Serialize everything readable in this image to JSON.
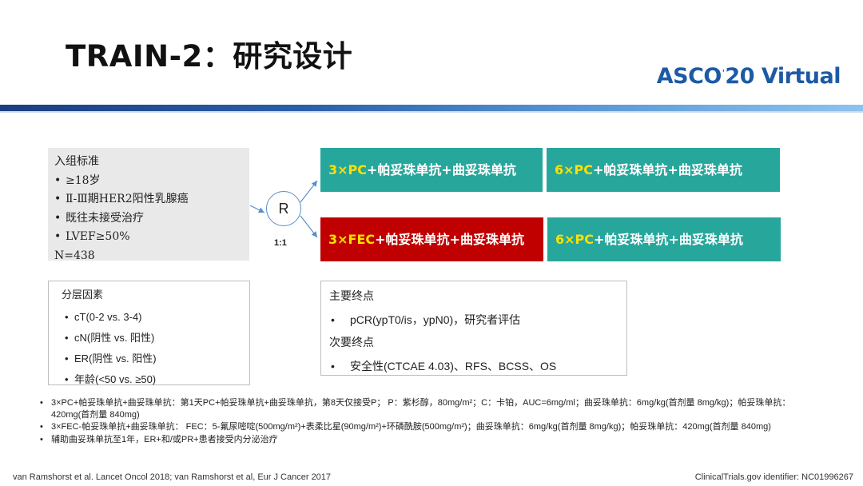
{
  "title": "TRAIN-2：研究设计",
  "logo": {
    "part1": "ASCO",
    "sup": "'",
    "part2": "20 Virtual"
  },
  "criteria": {
    "heading": "入组标准",
    "items": [
      "≥18岁",
      "Ⅱ-Ⅲ期HER2阳性乳腺癌",
      "既往未接受治疗",
      "LVEF≥50%"
    ],
    "n": "N=438"
  },
  "randomization": {
    "label": "R",
    "ratio": "1:1"
  },
  "arms": {
    "a1_p1_prefix": "3×PC",
    "a1_p1_rest": "+帕妥珠单抗+曲妥珠单抗",
    "a1_p2_prefix": "6×PC",
    "a1_p2_rest": "+帕妥珠单抗+曲妥珠单抗",
    "a2_p1_prefix": "3×FEC",
    "a2_p1_rest": "+帕妥珠单抗+曲妥珠单抗",
    "a2_p2_prefix": "6×PC",
    "a2_p2_rest": "+帕妥珠单抗+曲妥珠单抗"
  },
  "colors": {
    "teal": "#27a79c",
    "red": "#c00000",
    "highlight": "#ffe000",
    "brand": "#1c5aa5"
  },
  "stratification": {
    "heading": "分层因素",
    "items": [
      "cT(0-2 vs.  3-4)",
      "cN(阴性 vs. 阳性)",
      "ER(阴性 vs. 阳性)",
      "年龄(<50 vs.  ≥50)"
    ]
  },
  "endpoints": {
    "primary_heading": "主要终点",
    "primary_item": "pCR(ypT0/is，ypN0)，研究者评估",
    "secondary_heading": "次要终点",
    "secondary_item": "安全性(CTCAE 4.03)、RFS、BCSS、OS"
  },
  "notes": {
    "n1": "3×PC+帕妥珠单抗+曲妥珠单抗：第1天PC+帕妥珠单抗+曲妥珠单抗，第8天仅接受P； P：紫杉醇，80mg/m²；C：卡铂，AUC=6mg/ml；曲妥珠单抗：6mg/kg(首剂量 8mg/kg)；帕妥珠单抗：420mg(首剂量 840mg)",
    "n2": "3×FEC-帕妥珠单抗+曲妥珠单抗： FEC：5-氟尿嘧啶(500mg/m²)+表柔比星(90mg/m²)+环磷酰胺(500mg/m²)；曲妥珠单抗：6mg/kg(首剂量 8mg/kg)；帕妥珠单抗：420mg(首剂量 840mg)",
    "n3": "辅助曲妥珠单抗至1年，ER+和/或PR+患者接受内分泌治疗"
  },
  "footer": {
    "citation": "van Ramshorst et al. Lancet Oncol 2018; van Ramshorst et al, Eur J Cancer 2017",
    "identifier": "ClinicalTrials.gov identifier: NC01996267"
  }
}
